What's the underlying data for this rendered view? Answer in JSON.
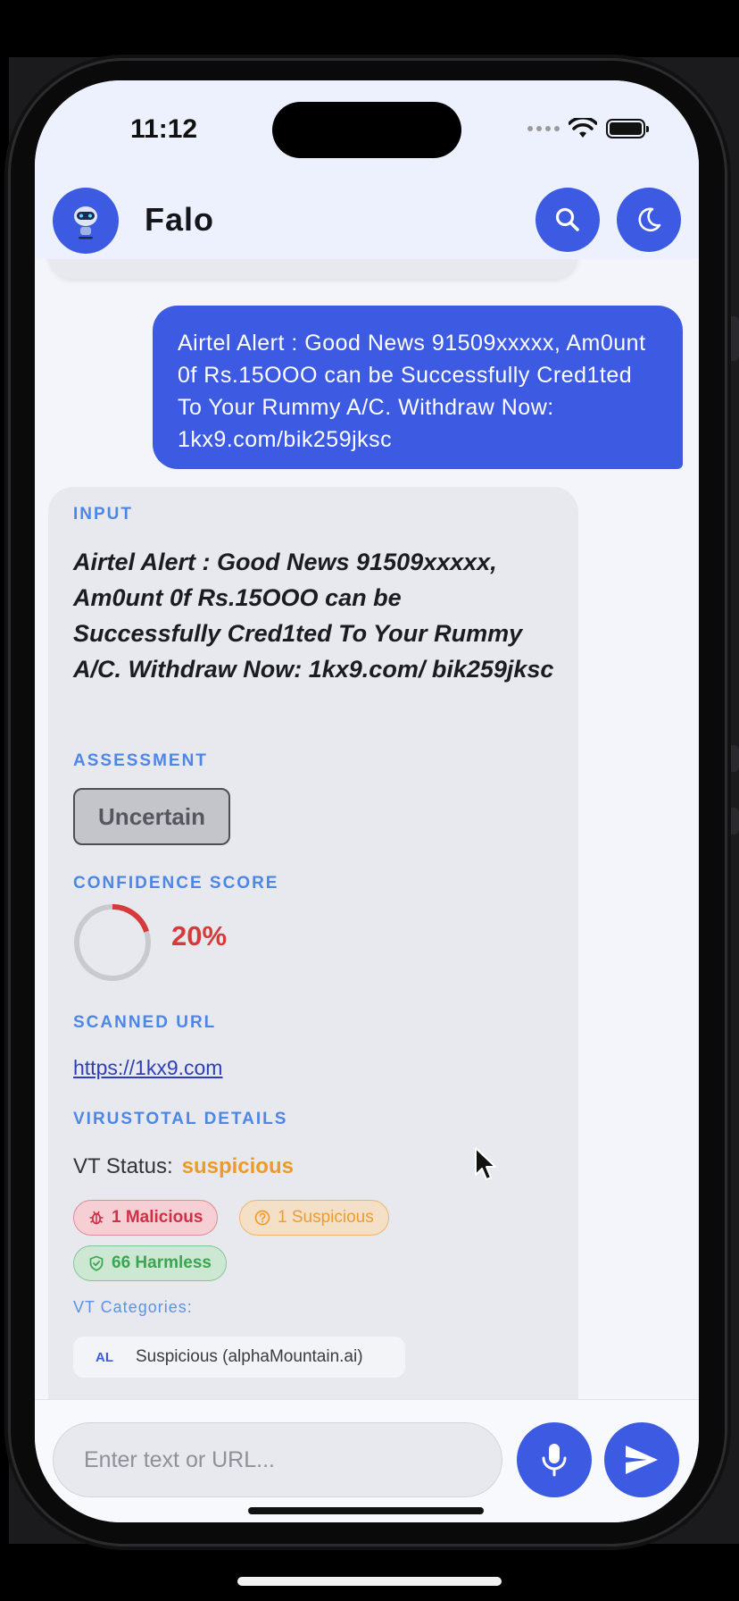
{
  "status_bar": {
    "time": "11:12"
  },
  "app_bar": {
    "title": "Falo"
  },
  "user_message": {
    "text": "Airtel Alert : Good News 91509xxxxx, Am0unt 0f Rs.15OOO can be Successfully Cred1ted To Your Rummy A/C. Withdraw Now: 1kx9.com/bik259jksc"
  },
  "result": {
    "input_label": "INPUT",
    "input_text": "Airtel Alert : Good News 91509xxxxx, Am0unt 0f Rs.15OOO can be Successfully Cred1ted To Your Rummy A/C. Withdraw Now: 1kx9.com/ bik259jksc",
    "assessment_label": "ASSESSMENT",
    "assessment_value": "Uncertain",
    "confidence_label": "CONFIDENCE SCORE",
    "confidence_value": "20%",
    "confidence_fraction": 0.2,
    "confidence_color": "#d63b3b",
    "scanned_url_label": "SCANNED URL",
    "scanned_url": "https://1kx9.com",
    "virustotal_label": "VIRUSTOTAL DETAILS",
    "vt_status_label": "VT Status:",
    "vt_status_value": "suspicious",
    "badges": {
      "malicious": "1 Malicious",
      "suspicious": "1 Suspicious",
      "harmless": "66 Harmless"
    },
    "vt_categories_label": "VT Categories:",
    "categories": [
      {
        "abbr": "AL",
        "text": "Suspicious (alphaMountain.ai)"
      }
    ]
  },
  "composer": {
    "placeholder": "Enter text or URL..."
  },
  "colors": {
    "primary": "#3d5be2",
    "section_label": "#4c86e6",
    "suspicious": "#ee9a25",
    "malicious": "#cf3046",
    "harmless": "#3aa552"
  }
}
